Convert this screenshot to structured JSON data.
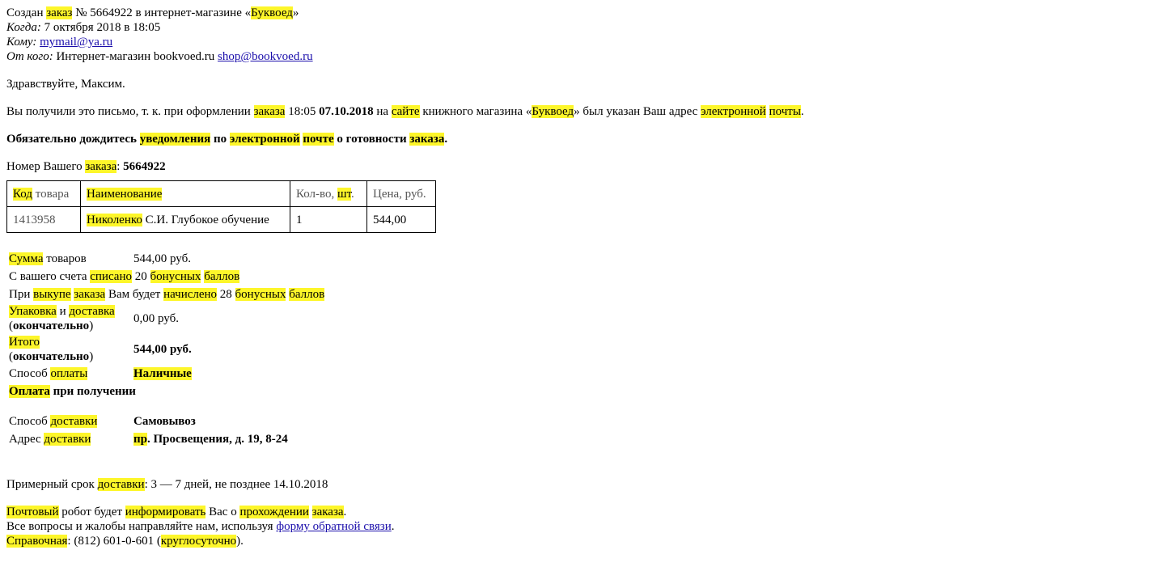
{
  "header": {
    "subject_pre": "Создан ",
    "subject_hl1": "заказ",
    "subject_mid": " № 5664922 в интернет-магазине «",
    "subject_hl2": "Буквоед",
    "subject_post": "»",
    "when_label": "Когда:",
    "when_value": " 7 октября 2018 в 18:05",
    "to_label": "Кому:",
    "to_email": "mymail@ya.ru",
    "from_label": "От кого:",
    "from_name": " Интернет-магазин bookvoed.ru ",
    "from_email": "shop@bookvoed.ru"
  },
  "body": {
    "greeting": "Здравствуйте, Максим.",
    "reason": {
      "t1": "Вы получили это письмо, т. к. при оформлении ",
      "h1": "заказа",
      "t2": " 18:05 ",
      "date_bold": "07.10.2018",
      "t3": " на ",
      "h2": "сайте",
      "t4": " книжного магазина «",
      "h3": "Буквоед",
      "t5": "» был указан Ваш адрес ",
      "h4": "электронной",
      "t6": " ",
      "h5": "почты",
      "t7": "."
    },
    "notice": {
      "t1": "Обязательно дождитесь ",
      "h1": "уведомления",
      "t2": " по ",
      "h2": "электронной",
      "t3": " ",
      "h3": "почте",
      "t4": " о готовности ",
      "h4": "заказа",
      "t5": "."
    },
    "order_number": {
      "t1": "Номер Вашего ",
      "h1": "заказа",
      "t2": ": ",
      "number": "5664922"
    }
  },
  "items_table": {
    "headers": {
      "code_hl": "Код",
      "code_rest": " товара",
      "name_hl": "Наименование",
      "qty_pre": "Кол-во, ",
      "qty_hl": "шт",
      "qty_post": ".",
      "price": "Цена, руб."
    },
    "rows": [
      {
        "code": "1413958",
        "name_hl": "Николенко",
        "name_rest": " С.И. Глубокое обучение",
        "qty": "1",
        "price": "544,00"
      }
    ]
  },
  "summary": {
    "goods_sum": {
      "hl": "Сумма",
      "rest": " товаров",
      "value": "544,00 руб."
    },
    "bonus_spent": {
      "t1": "С вашего счета ",
      "h1": "списано",
      "t2": " 20 ",
      "h2": "бонусных",
      "t3": " ",
      "h3": "баллов"
    },
    "bonus_earned": {
      "t1": "При ",
      "h1": "выкупе",
      "t2": " ",
      "h2": "заказа",
      "t3": " Вам будет ",
      "h3": "начислено",
      "t4": " 28 ",
      "h4": "бонусных",
      "t5": " ",
      "h5": "баллов"
    },
    "packing": {
      "h1": "Упаковка",
      "t1": " и ",
      "h2": "доставка",
      "t2": " (",
      "bold": "окончательно",
      "t3": ")",
      "value": "0,00 руб."
    },
    "total": {
      "h1": "Итого",
      "t1": " (",
      "bold": "окончательно",
      "t2": ")",
      "value": "544,00 руб."
    },
    "payment": {
      "t1": "Способ ",
      "h1": "оплаты",
      "value": "Наличные"
    },
    "payment_note": {
      "h1": "Оплата",
      "t1": " при получении"
    },
    "delivery": {
      "t1": "Способ ",
      "h1": "доставки",
      "value": "Самовывоз"
    },
    "address": {
      "t1": "Адрес ",
      "h1": "доставки",
      "v_hl": "пр",
      "v_rest": ". Просвещения, д. 19, 8-24"
    }
  },
  "footer": {
    "term": {
      "t1": "Примерный срок ",
      "h1": "доставки",
      "t2": ": 3 — 7 дней, не позднее 14.10.2018"
    },
    "robot": {
      "h1": "Почтовый",
      "t1": " робот будет ",
      "h2": "информировать",
      "t2": " Вас о ",
      "h3": "прохождении",
      "t3": " ",
      "h4": "заказа",
      "t4": "."
    },
    "questions": {
      "t1": "Все вопросы и жалобы направляйте нам, используя ",
      "link": "форму обратной связи",
      "t2": "."
    },
    "phone": {
      "h1": "Справочная",
      "t1": ": (812) 601-0-601 (",
      "h2": "круглосуточно",
      "t2": ")."
    }
  },
  "colors": {
    "highlight": "#fdf62a",
    "link": "#1a0dab"
  }
}
